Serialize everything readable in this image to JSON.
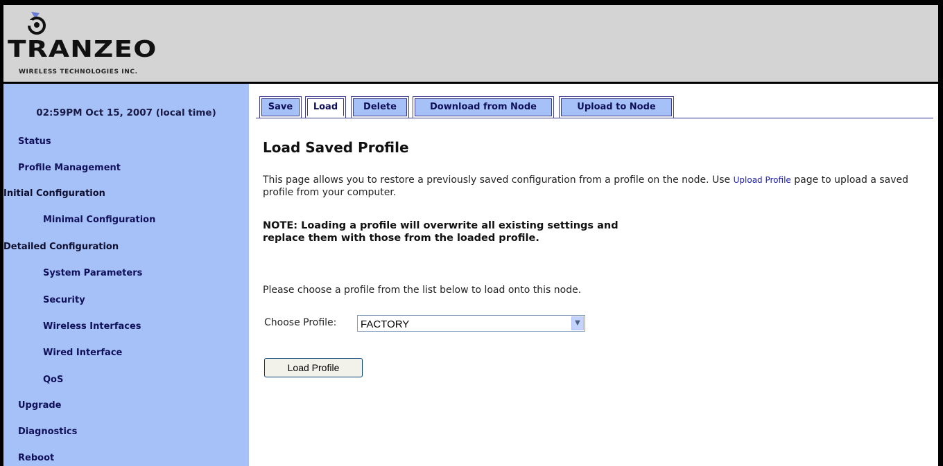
{
  "brand": {
    "logo_text": "TRANZEO",
    "logo_subtitle": "WIRELESS TECHNOLOGIES INC."
  },
  "sidebar": {
    "datetime": "02:59PM Oct 15, 2007 (local time)",
    "items": [
      {
        "label": "Status"
      },
      {
        "label": "Profile Management"
      },
      {
        "label": "Initial Configuration"
      },
      {
        "label": "Minimal Configuration"
      },
      {
        "label": "Detailed Configuration"
      },
      {
        "label": "System Parameters"
      },
      {
        "label": "Security"
      },
      {
        "label": "Wireless Interfaces"
      },
      {
        "label": "Wired Interface"
      },
      {
        "label": "QoS"
      },
      {
        "label": "Upgrade"
      },
      {
        "label": "Diagnostics"
      },
      {
        "label": "Reboot"
      }
    ]
  },
  "tabs": [
    {
      "label": "Save"
    },
    {
      "label": "Load",
      "active": true
    },
    {
      "label": "Delete"
    },
    {
      "label": "Download from Node"
    },
    {
      "label": "Upload to Node"
    }
  ],
  "main": {
    "title": "Load Saved Profile",
    "intro_text": "This page allows you to restore a previously saved configuration from a profile on the node. Use",
    "intro_link": "Upload Profile",
    "intro_text_after": "page to upload a saved profile from your computer.",
    "note": "NOTE: Loading a profile will overwrite all existing settings and replace them with those from the loaded profile.",
    "choose_text": "Please choose a profile from the list below to load onto this node.",
    "choose_label": "Choose Profile:",
    "selected_profile": "FACTORY",
    "load_button": "Load Profile"
  },
  "colors": {
    "sidebar_bg": "#a6c1f7",
    "header_bg": "#d4d4d4",
    "nav_text": "#10105a",
    "link": "#1a1aaa"
  }
}
